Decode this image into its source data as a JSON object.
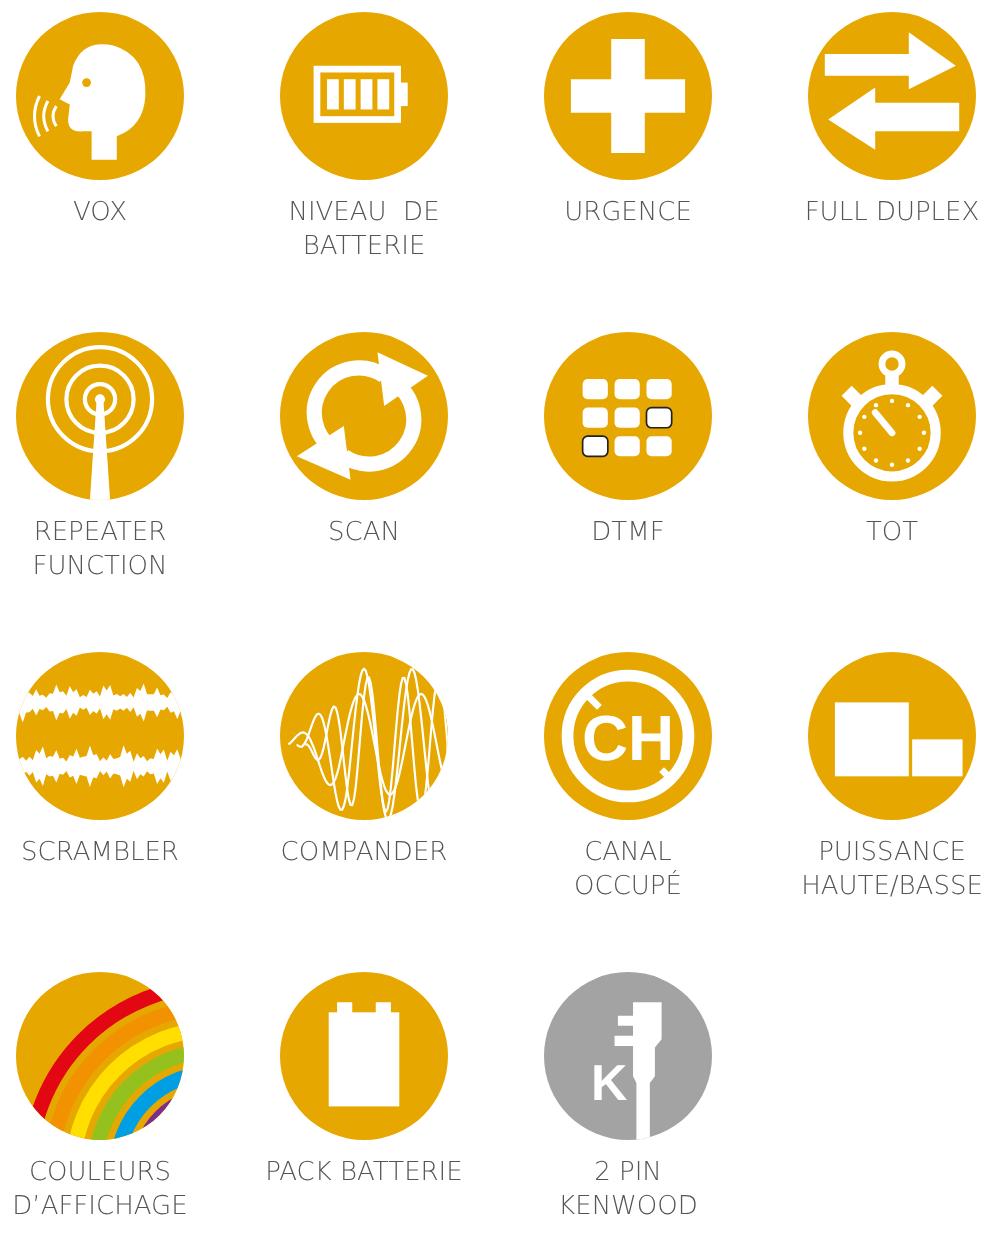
{
  "features": [
    {
      "label": "VOX",
      "kind": "vox",
      "color": "#e6a700"
    },
    {
      "label": "NIVEAU  DE\nBATTERIE",
      "kind": "battery",
      "color": "#e6a700"
    },
    {
      "label": "URGENCE",
      "kind": "cross",
      "color": "#e6a700"
    },
    {
      "label": "FULL DUPLEX",
      "kind": "duplex",
      "color": "#e6a700"
    },
    {
      "label": "REPEATER\nFUNCTION",
      "kind": "repeater",
      "color": "#e6a700"
    },
    {
      "label": "SCAN",
      "kind": "scan",
      "color": "#e6a700"
    },
    {
      "label": "DTMF",
      "kind": "dtmf",
      "color": "#e6a700"
    },
    {
      "label": "TOT",
      "kind": "timer",
      "color": "#e6a700"
    },
    {
      "label": "SCRAMBLER",
      "kind": "scrambler",
      "color": "#e6a700"
    },
    {
      "label": "COMPANDER",
      "kind": "compander",
      "color": "#e6a700"
    },
    {
      "label": "CANAL\nOCCUPÉ",
      "kind": "busy",
      "color": "#e6a700",
      "icon_text": "CH"
    },
    {
      "label": "PUISSANCE\nHAUTE/BASSE",
      "kind": "power",
      "color": "#e6a700"
    },
    {
      "label": "COULEURS\nD’AFFICHAGE",
      "kind": "rainbow",
      "color": "#e6a700"
    },
    {
      "label": "PACK BATTERIE",
      "kind": "pack",
      "color": "#e6a700"
    },
    {
      "label": "2 PIN\nKENWOOD",
      "kind": "plug",
      "color": "#a3a3a3",
      "icon_text": "K"
    }
  ]
}
